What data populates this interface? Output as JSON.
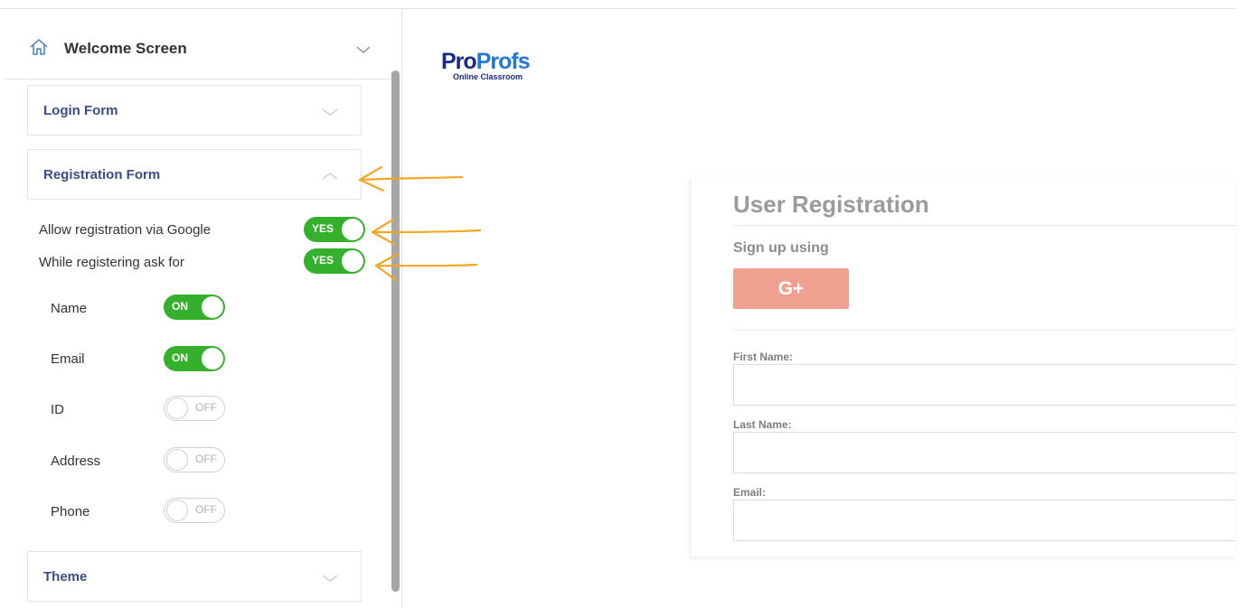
{
  "sidebar": {
    "welcome": {
      "title": "Welcome Screen",
      "icon": "home-icon"
    },
    "sections": {
      "login": "Login Form",
      "registration": "Registration Form",
      "theme": "Theme"
    },
    "options": {
      "google": {
        "label": "Allow registration via Google",
        "state": "YES"
      },
      "ask_for": {
        "label": "While registering ask for",
        "state": "YES"
      }
    },
    "fields": [
      {
        "label": "Name",
        "state": "ON"
      },
      {
        "label": "Email",
        "state": "ON"
      },
      {
        "label": "ID",
        "state": "OFF"
      },
      {
        "label": "Address",
        "state": "OFF"
      },
      {
        "label": "Phone",
        "state": "OFF"
      }
    ]
  },
  "logo": {
    "word_pro": "Pro",
    "word_profs": "Profs",
    "tagline": "Online Classroom"
  },
  "preview": {
    "title": "User Registration",
    "signup_label": "Sign up using",
    "google_button": "G+",
    "fields": [
      "First Name:",
      "Last Name:",
      "Email:"
    ]
  },
  "colors": {
    "toggle_on": "#35b02c",
    "section_label": "#3a4c8a",
    "google_button": "#f0a08e",
    "annotation_arrow": "#f5a623"
  }
}
